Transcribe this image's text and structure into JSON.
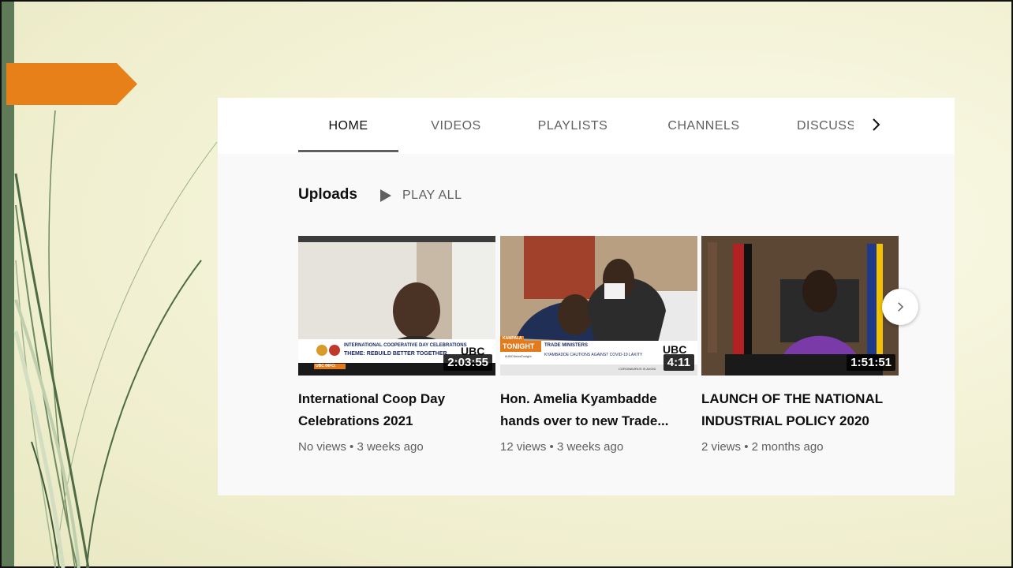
{
  "tabs": [
    {
      "label": "HOME",
      "active": true
    },
    {
      "label": "VIDEOS",
      "active": false
    },
    {
      "label": "PLAYLISTS",
      "active": false
    },
    {
      "label": "CHANNELS",
      "active": false
    },
    {
      "label": "DISCUSSION",
      "active": false
    }
  ],
  "section": {
    "title": "Uploads",
    "play_all": "PLAY ALL"
  },
  "videos": [
    {
      "title": "International Coop Day Celebrations 2021",
      "duration": "2:03:55",
      "views": "No views",
      "age": "3 weeks ago",
      "thumb_ticker_top": "INTERNATIONAL COOPERATIVE DAY CELEBRATIONS",
      "thumb_ticker_bottom": "THEME: REBUILD BETTER TOGETHER",
      "thumb_tag": "UBC INFO:",
      "thumb_logo": "UBC"
    },
    {
      "title": "Hon. Amelia Kyambadde hands over to new Trade...",
      "duration": "4:11",
      "views": "12 views",
      "age": "3 weeks ago",
      "thumb_place": "KAMPALA",
      "thumb_show": "TONIGHT",
      "thumb_headline": "TRADE MINISTERS",
      "thumb_sub": "KYAMBADDE CAUTIONS AGAINST COVID-19 LAXITY",
      "thumb_hashtag": "#UBCNewsTonight",
      "thumb_crawl": "CORONAVIRUS IS AVOID",
      "thumb_logo": "UBC"
    },
    {
      "title": "LAUNCH OF THE NATIONAL INDUSTRIAL POLICY 2020",
      "duration": "1:51:51",
      "views": "2 views",
      "age": "2 months ago"
    }
  ],
  "meta_separator": "•",
  "icons": {
    "tabs_scroll": "chevron-right-icon",
    "play_all": "play-icon",
    "carousel_next": "chevron-right-icon"
  },
  "colors": {
    "slide_accent": "#e8801a",
    "slide_bar": "#5e7a57",
    "text_primary": "#0f0f0f",
    "text_secondary": "#606060"
  }
}
